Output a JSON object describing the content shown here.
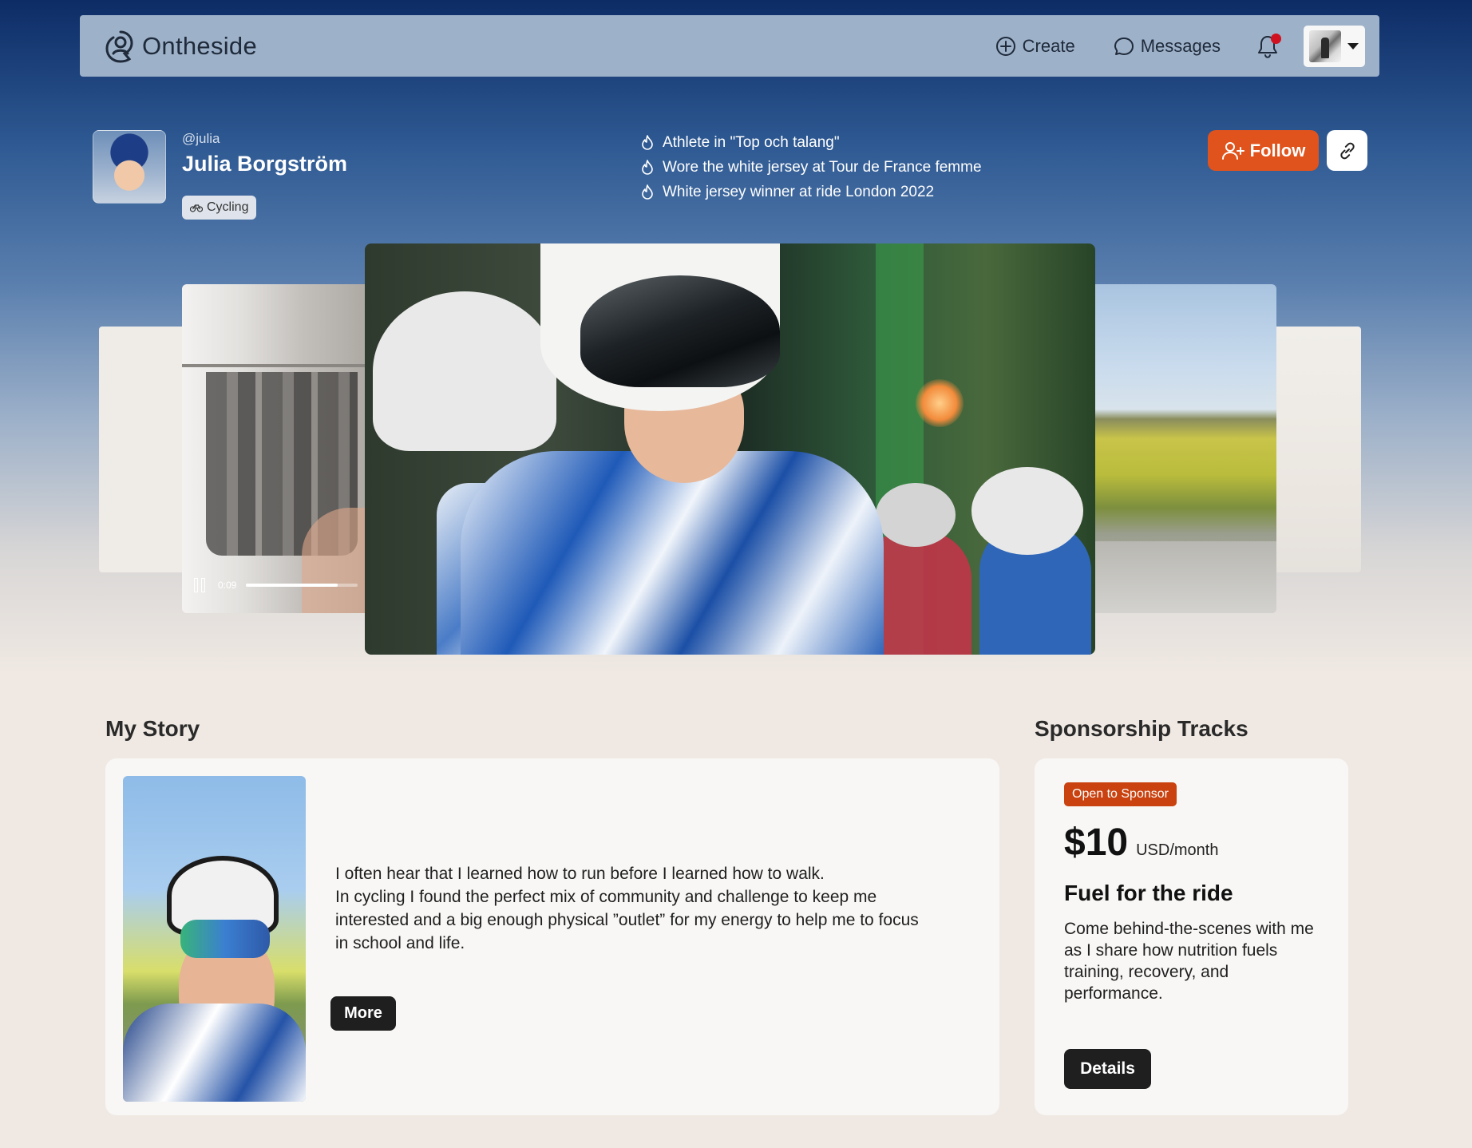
{
  "app": {
    "name": "Ontheside"
  },
  "nav": {
    "create_label": "Create",
    "messages_label": "Messages",
    "notifications_unread": true
  },
  "profile": {
    "handle": "@julia",
    "name": "Julia Borgström",
    "sport": "Cycling",
    "achievements": [
      "Athlete in \"Top och talang\"",
      "Wore the white jersey at Tour de France femme",
      "White jersey winner at ride London 2022"
    ],
    "follow_label": "Follow"
  },
  "media": {
    "video_time": "0:09",
    "video_progress": 0.82
  },
  "story": {
    "title": "My Story",
    "paragraph_1": "I often hear that I learned how to run before I learned how to walk.",
    "paragraph_2": "In cycling I found the perfect mix of community and challenge to keep me interested and a big enough physical ”outlet” for my energy to help me to focus in school and life.",
    "more_label": "More"
  },
  "sponsorship": {
    "title": "Sponsorship Tracks",
    "badge": "Open to Sponsor",
    "price": "$10",
    "price_unit": "USD/month",
    "track_name": "Fuel for the ride",
    "description": "Come behind-the-scenes with me as I share how nutrition fuels training, recovery, and performance.",
    "details_label": "Details"
  },
  "colors": {
    "accent": "#e0531c",
    "badge": "#c9420f",
    "nav_bg": "#9db1c9",
    "page_bg": "#f0e9e3",
    "dark_button": "#1f1f1f",
    "notification_dot": "#d0111f"
  },
  "icons": {
    "create": "plus-circle-icon",
    "messages": "chat-bubble-icon",
    "notifications": "bell-icon",
    "achievement": "flame-icon",
    "follow": "add-user-icon",
    "share": "link-icon",
    "sport": "bike-icon"
  }
}
